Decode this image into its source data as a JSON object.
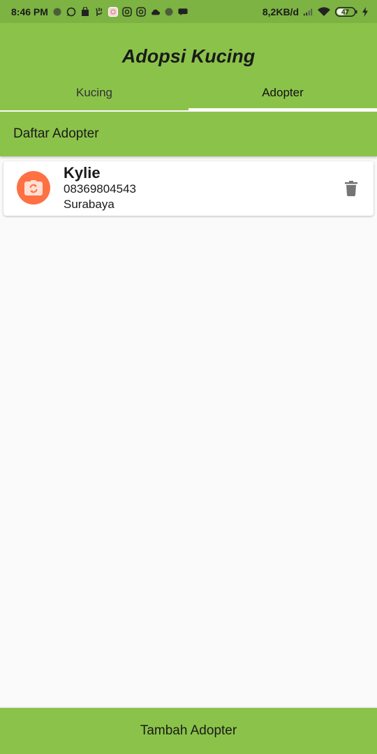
{
  "status_bar": {
    "time": "8:46 PM",
    "network_speed": "8,2KB/d",
    "battery": "47",
    "left_icons": [
      "dot-icon",
      "whatsapp-icon",
      "shop-icon",
      "hand-icon",
      "app-icon",
      "instagram-icon",
      "instagram-icon",
      "cloud-icon",
      "dot-icon",
      "chat-icon"
    ],
    "right_icons": [
      "signal-icon",
      "wifi-icon",
      "battery-icon",
      "charging-icon"
    ]
  },
  "appbar": {
    "title": "Adopsi Kucing",
    "tabs": [
      {
        "label": "Kucing",
        "active": false
      },
      {
        "label": "Adopter",
        "active": true
      }
    ]
  },
  "section": {
    "title": "Daftar Adopter"
  },
  "adopters": [
    {
      "name": "Kylie",
      "phone": "08369804543",
      "city": "Surabaya",
      "avatar_icon": "camera-switch-icon",
      "action_icon": "trash-icon"
    }
  ],
  "footer": {
    "add_button_label": "Tambah Adopter"
  },
  "colors": {
    "primary": "#8bc34a",
    "status_bar": "#7cb342",
    "avatar": "#ff7043",
    "background": "#fafafa"
  }
}
